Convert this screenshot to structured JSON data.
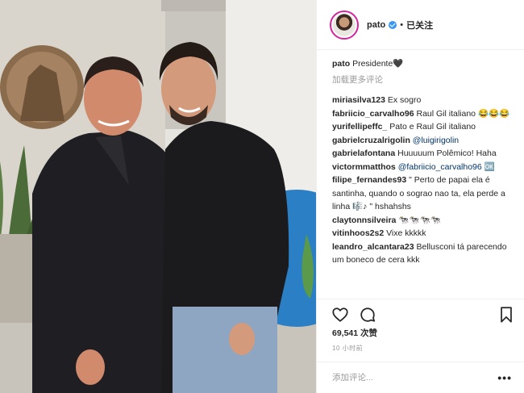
{
  "post": {
    "author": "pato",
    "follow_state": "已关注",
    "separator": "•",
    "caption_user": "pato",
    "caption_text": "Presidente🖤",
    "load_more": "加载更多评论",
    "likes": "69,541 次赞",
    "time": "10 小时前"
  },
  "comments": [
    {
      "user": "miriasilva123",
      "text": "Ex sogro"
    },
    {
      "user": "fabriicio_carvalho96",
      "text": "Raul Gil italiano 😂😂😂"
    },
    {
      "user": "yurifellipeffc_",
      "text": "Pato e Raul Gil italiano"
    },
    {
      "user": "gabrielcruzalrigolin",
      "mention": "@luigirigolin"
    },
    {
      "user": "gabrielafontana",
      "text": "Huuuuum Polêmico! Haha"
    },
    {
      "user": "victormmatthos",
      "mention": "@fabriicio_carvalho96",
      "text_after": " 🆗"
    },
    {
      "user": "filipe_fernandes93",
      "text": "\" Perto de papai ela é santinha, quando o sograo nao ta, ela perde a linha 🎼♪ \" hshahshs"
    },
    {
      "user": "claytonnsilveira",
      "text": "🐄🐄🐄🐄"
    },
    {
      "user": "vitinhoos2s2",
      "text": "Vixe kkkkk"
    },
    {
      "user": "leandro_alcantara23",
      "text": "Bellusconi tá parecendo um boneco de cera kkk"
    }
  ],
  "add_comment": {
    "placeholder": "添加评论...",
    "more": "•••"
  },
  "icons": {
    "like": "heart-icon",
    "comment": "comment-bubble-icon",
    "save": "bookmark-icon",
    "verified": "verified-badge-icon"
  },
  "colors": {
    "verified": "#3897f0",
    "mention": "#003569",
    "muted": "#999999"
  }
}
